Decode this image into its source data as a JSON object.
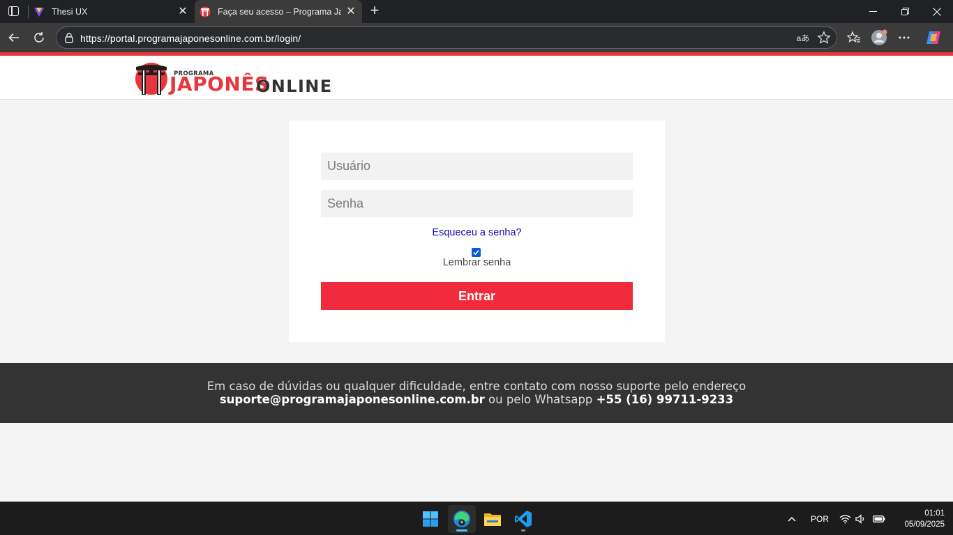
{
  "browser": {
    "tabs": [
      {
        "title": "Thesi UX",
        "active": false
      },
      {
        "title": "Faça seu acesso – Programa Japonês Online",
        "active": true
      }
    ],
    "url": "https://portal.programajaponesonline.com.br/login/",
    "icons": [
      "tab-manager-icon",
      "close-icon",
      "plus-icon",
      "minimize-icon",
      "restore-icon",
      "back-icon",
      "refresh-icon",
      "lock-icon",
      "read-aloud-icon",
      "star-icon",
      "favorites-icon",
      "profile-icon",
      "more-icon",
      "copilot-icon"
    ],
    "read_aloud_glyph": "aあ"
  },
  "site": {
    "logo_small": "PROGRAMA",
    "logo_red": "JAPONÊS",
    "logo_dark": "ONLINE",
    "brand_red": "#ef2b3c"
  },
  "login": {
    "username_placeholder": "Usuário",
    "password_placeholder": "Senha",
    "forgot_link": "Esqueceu a senha?",
    "remember_label": "Lembrar senha",
    "remember_checked": true,
    "submit_label": "Entrar"
  },
  "footer": {
    "line1": "Em caso de dúvidas ou qualquer dificuldade, entre contato com nosso suporte pelo endereço",
    "email": "suporte@programajaponesonline.com.br",
    "middle": " ou pelo Whatsapp ",
    "phone": "+55 (16) 99711-9233"
  },
  "taskbar": {
    "apps": [
      "windows-start",
      "edge",
      "file-explorer",
      "vscode"
    ],
    "language": "POR",
    "time": "01:01",
    "date": "05/09/2025"
  }
}
